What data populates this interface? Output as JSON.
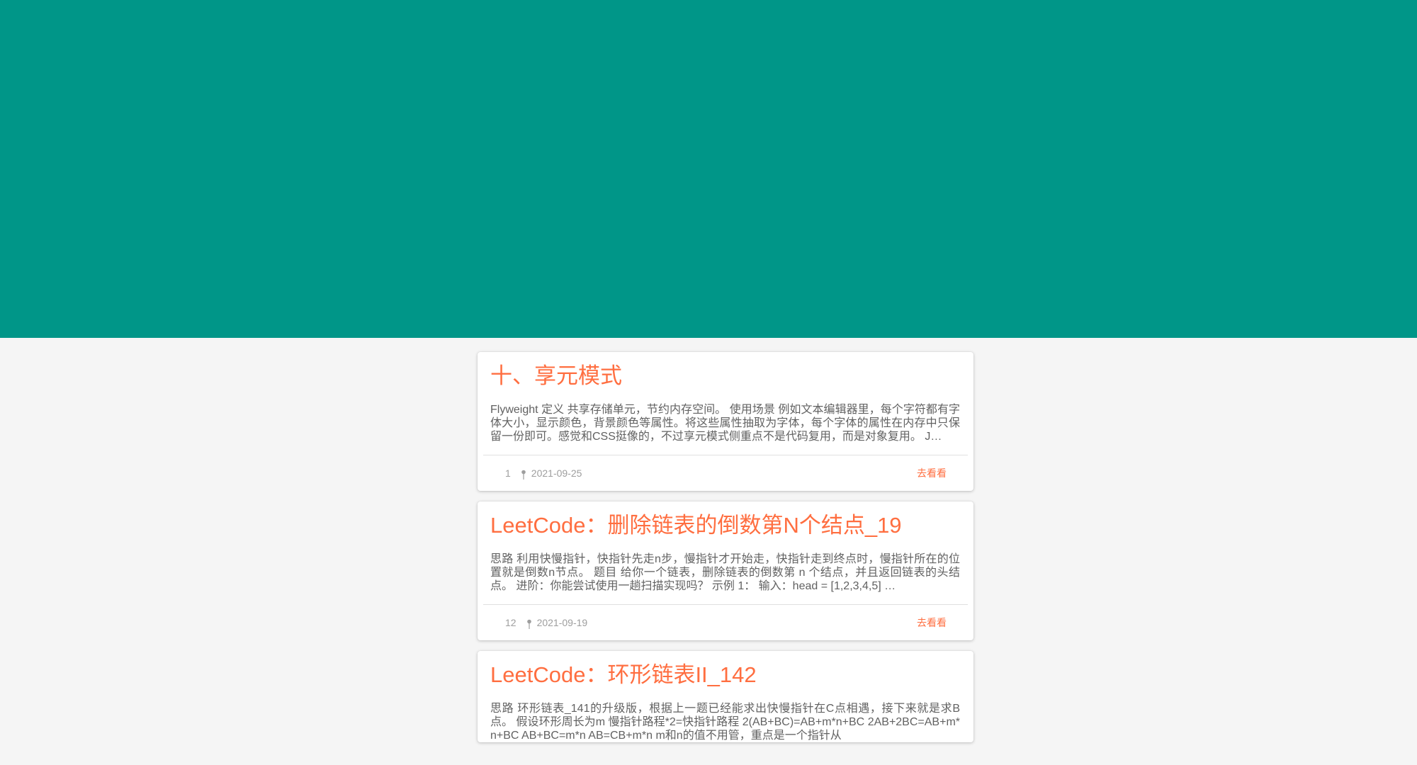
{
  "theme": {
    "header_color": "#009688",
    "accent": "#ff6e40",
    "background": "#f5f5f5"
  },
  "posts": [
    {
      "title": "十、享元模式",
      "excerpt": "Flyweight 定义 共享存储单元，节约内存空间。 使用场景 例如文本编辑器里，每个字符都有字体大小，显示颜色，背景颜色等属性。将这些属性抽取为字体，每个字体的属性在内存中只保留一份即可。感觉和CSS挺像的，不过享元模式侧重点不是代码复用，而是对象复用。 J…",
      "views": "1",
      "date": "2021-09-25",
      "link_label": "去看看"
    },
    {
      "title": "LeetCode：删除链表的倒数第N个结点_19",
      "excerpt": "思路 利用快慢指针，快指针先走n步，慢指针才开始走，快指针走到终点时，慢指针所在的位置就是倒数n节点。 题目 给你一个链表，删除链表的倒数第 n 个结点，并且返回链表的头结点。 进阶：你能尝试使用一趟扫描实现吗？   示例 1： 输入：head = [1,2,3,4,5] …",
      "views": "12",
      "date": "2021-09-19",
      "link_label": "去看看"
    },
    {
      "title": "LeetCode：环形链表II_142",
      "excerpt": "思路 环形链表_141的升级版，根据上一题已经能求出快慢指针在C点相遇，接下来就是求B点。 假设环形周长为m 慢指针路程*2=快指针路程 2(AB+BC)=AB+m*n+BC 2AB+2BC=AB+m*n+BC AB+BC=m*n AB=CB+m*n m和n的值不用管，重点是一个指针从",
      "views": "",
      "date": "",
      "link_label": ""
    }
  ]
}
